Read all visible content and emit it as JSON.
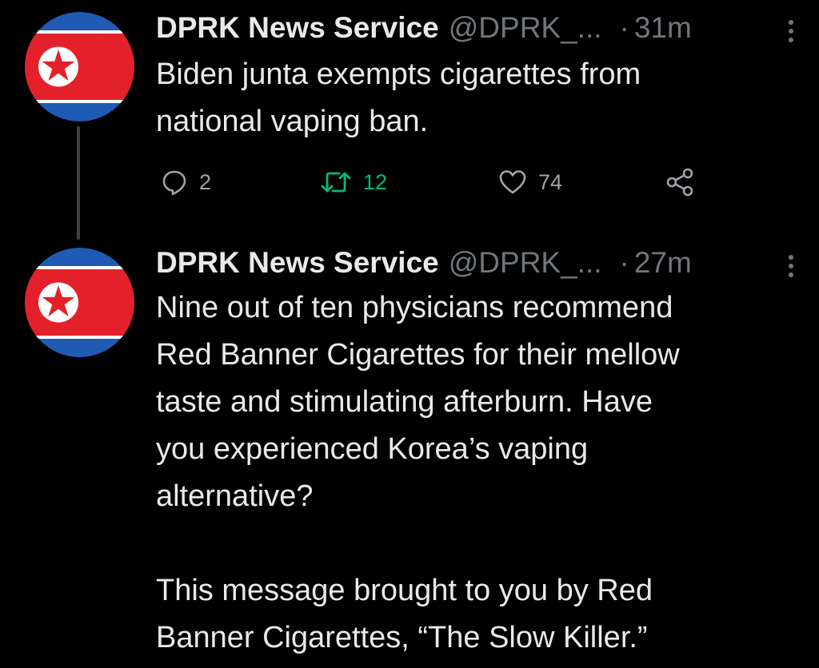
{
  "tweets": [
    {
      "display_name": "DPRK News Service",
      "handle": "@DPRK_...",
      "separator": "·",
      "time": "31m",
      "text": "Biden junta exempts cigarettes from\nnational vaping ban.",
      "actions": {
        "reply_count": "2",
        "retweet_count": "12",
        "like_count": "74"
      },
      "retweeted": true
    },
    {
      "display_name": "DPRK News Service",
      "handle": "@DPRK_...",
      "separator": "·",
      "time": "27m",
      "text": "Nine out of ten physicians recommend\nRed Banner Cigarettes for their mellow\ntaste and stimulating afterburn. Have\nyou experienced Korea’s vaping\nalternative?\n\nThis message brought to you by Red\nBanner Cigarettes, “The Slow Killer.”"
    }
  ],
  "colors": {
    "background": "#000000",
    "text_primary": "#e7e9ea",
    "text_secondary": "#71767b",
    "retweet_active": "#00ba7c",
    "thread_line": "#3e4144",
    "flag_blue": "#1f5bb5",
    "flag_red": "#e4212b"
  },
  "icons": [
    "dprk-flag-avatar",
    "more-icon",
    "reply-icon",
    "retweet-icon",
    "like-icon",
    "share-icon"
  ]
}
